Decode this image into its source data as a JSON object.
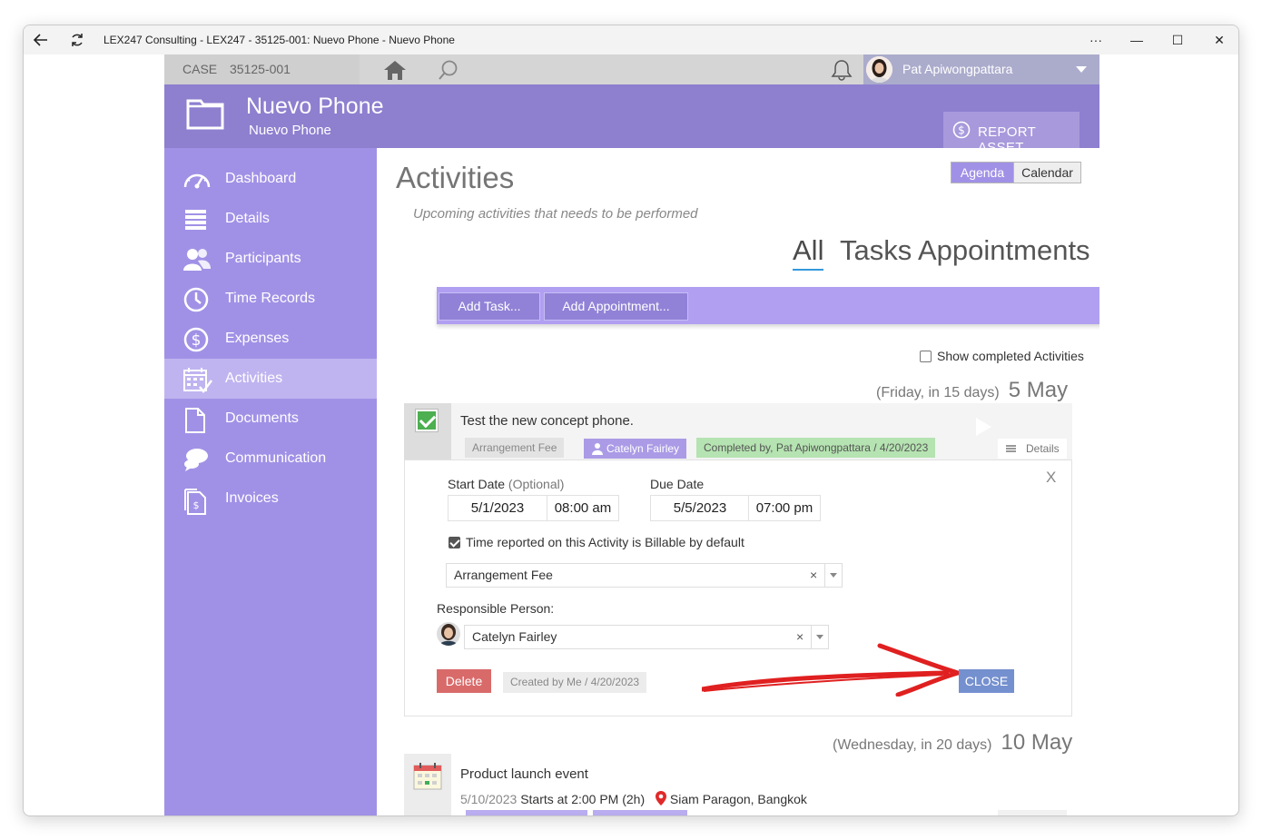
{
  "window": {
    "title": "LEX247 Consulting - LEX247 - 35125-001: Nuevo Phone - Nuevo Phone",
    "controls": {
      "more": "···",
      "minimize": "—",
      "maximize": "☐",
      "close": "✕"
    }
  },
  "topbar": {
    "case_label": "CASE",
    "case_number": "35125-001",
    "user_name": "Pat Apiwongpattara",
    "icons": [
      "home-icon",
      "search-icon",
      "bell-icon"
    ]
  },
  "header": {
    "title": "Nuevo Phone",
    "subtitle": "Nuevo Phone",
    "report_button": "REPORT ASSET"
  },
  "sidebar": {
    "items": [
      {
        "label": "Dashboard",
        "icon": "dashboard-icon"
      },
      {
        "label": "Details",
        "icon": "details-icon"
      },
      {
        "label": "Participants",
        "icon": "participants-icon"
      },
      {
        "label": "Time Records",
        "icon": "clock-icon"
      },
      {
        "label": "Expenses",
        "icon": "dollar-icon"
      },
      {
        "label": "Activities",
        "icon": "calendar-check-icon",
        "active": true
      },
      {
        "label": "Documents",
        "icon": "document-icon"
      },
      {
        "label": "Communication",
        "icon": "chat-icon"
      },
      {
        "label": "Invoices",
        "icon": "invoice-icon"
      }
    ]
  },
  "main": {
    "title": "Activities",
    "subtitle": "Upcoming activities that needs to be performed",
    "view_toggle": {
      "agenda": "Agenda",
      "calendar": "Calendar",
      "selected": "Agenda"
    },
    "filters": {
      "all": "All",
      "tasks": "Tasks",
      "appointments": "Appointments",
      "selected": "All"
    },
    "actions": {
      "add_task": "Add Task...",
      "add_appointment": "Add Appointment..."
    },
    "show_completed": {
      "label": "Show completed Activities",
      "checked": false
    }
  },
  "day1": {
    "relative": "(Friday, in 15 days)",
    "date": "5 May"
  },
  "task": {
    "title": "Test the new concept phone.",
    "completed": true,
    "tag_fee": "Arrangement Fee",
    "tag_person": "Catelyn Fairley",
    "tag_completed": "Completed by, Pat Apiwongpattara / 4/20/2023",
    "details": "Details",
    "panel": {
      "close_x": "X",
      "start_label": "Start Date",
      "start_optional": "(Optional)",
      "start_date": "5/1/2023",
      "start_time": "08:00 am",
      "due_label": "Due Date",
      "due_date": "5/5/2023",
      "due_time": "07:00 pm",
      "billable_label": "Time reported on this Activity is Billable by default",
      "billable_checked": true,
      "fee_value": "Arrangement Fee",
      "clear_glyph": "×",
      "responsible_label": "Responsible Person:",
      "responsible_value": "Catelyn Fairley",
      "delete": "Delete",
      "created_by": "Created by Me / 4/20/2023",
      "close": "CLOSE"
    }
  },
  "day2": {
    "relative": "(Wednesday, in 20 days)",
    "date": "10 May"
  },
  "event": {
    "title": "Product launch event",
    "date": "5/10/2023",
    "time": "Starts at 2:00 PM (2h)",
    "location": "Siam Paragon, Bangkok"
  },
  "colors": {
    "accent_purple": "#8e7fcf",
    "sidebar": "#a191e6",
    "action_bar": "#b19ff1",
    "close_button": "#7590cf",
    "delete_button": "#d96a6a",
    "annotation_arrow": "#e02020"
  }
}
